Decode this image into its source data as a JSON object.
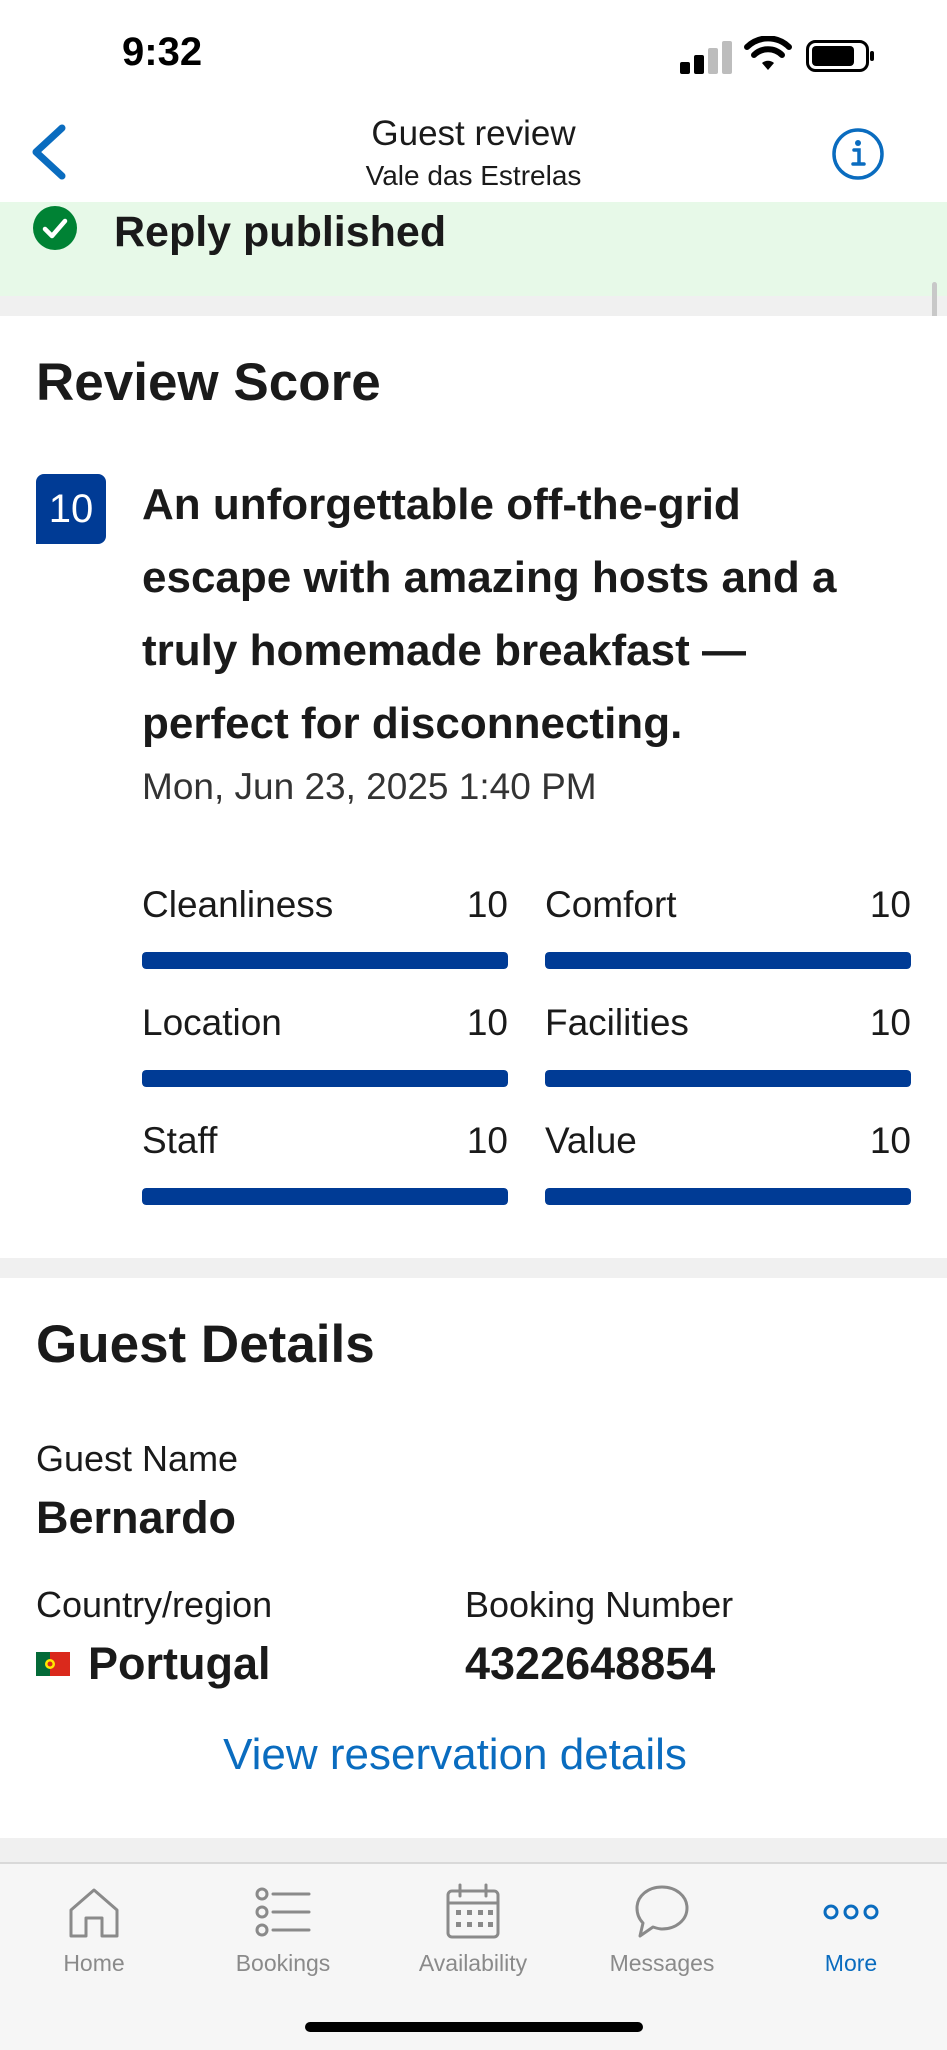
{
  "status_bar": {
    "time": "9:32"
  },
  "nav": {
    "title": "Guest review",
    "subtitle": "Vale das Estrelas"
  },
  "banner": {
    "text": "Reply published"
  },
  "review_score": {
    "section_title": "Review Score",
    "score": "10",
    "headline": "An unforgettable off-the-grid escape with amazing hosts and a truly homemade breakfast — perfect for disconnecting.",
    "date": "Mon, Jun 23, 2025 1:40 PM",
    "max_score": 10,
    "subscores": [
      {
        "label": "Cleanliness",
        "value": "10"
      },
      {
        "label": "Comfort",
        "value": "10"
      },
      {
        "label": "Location",
        "value": "10"
      },
      {
        "label": "Facilities",
        "value": "10"
      },
      {
        "label": "Staff",
        "value": "10"
      },
      {
        "label": "Value",
        "value": "10"
      }
    ]
  },
  "guest_details": {
    "section_title": "Guest Details",
    "name_label": "Guest Name",
    "name": "Bernardo",
    "country_label": "Country/region",
    "country": "Portugal",
    "booking_label": "Booking Number",
    "booking_number": "4322648854",
    "link": "View reservation details"
  },
  "tab_bar": {
    "tabs": [
      {
        "label": "Home",
        "icon": "home-icon"
      },
      {
        "label": "Bookings",
        "icon": "list-icon"
      },
      {
        "label": "Availability",
        "icon": "calendar-icon"
      },
      {
        "label": "Messages",
        "icon": "chat-bubble-icon"
      },
      {
        "label": "More",
        "icon": "more-dots-icon"
      }
    ],
    "active": "More"
  },
  "colors": {
    "brand_blue": "#003b95",
    "link_blue": "#0a6cbf",
    "success_green": "#008234",
    "banner_bg": "#e7f9e8"
  }
}
